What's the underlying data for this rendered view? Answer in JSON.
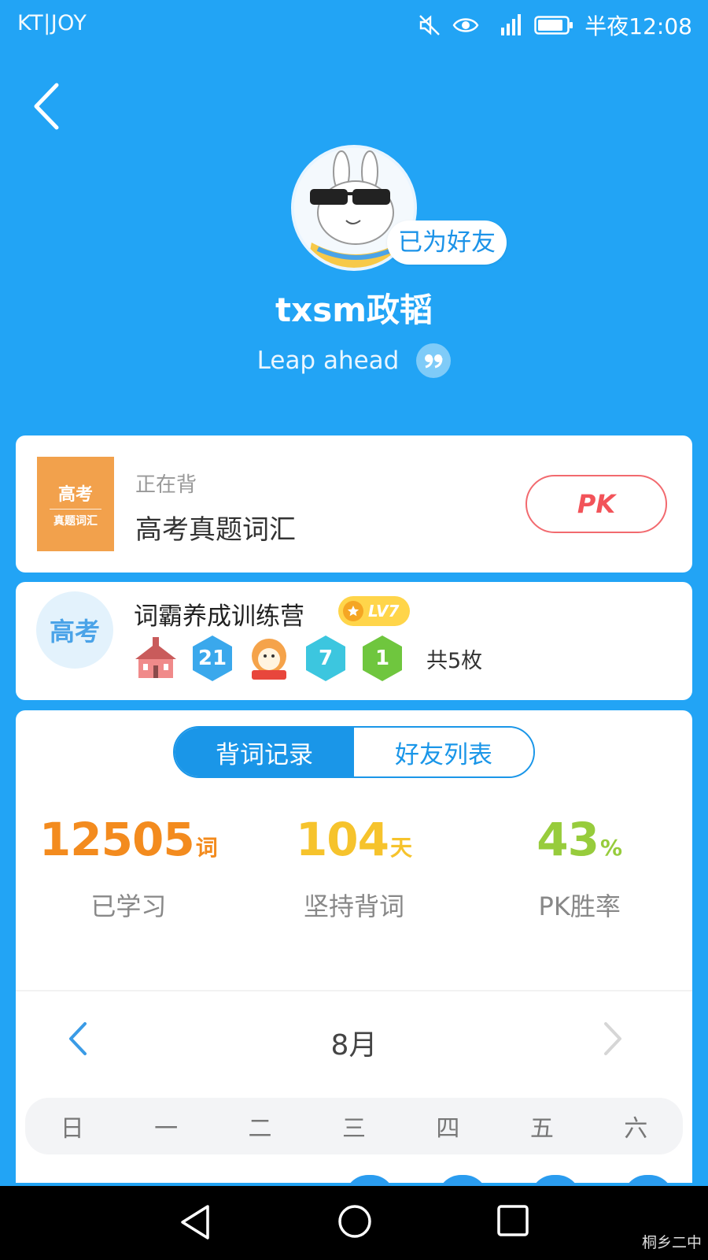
{
  "status_bar": {
    "carrier": "KT|JOY",
    "network": "H R",
    "time": "半夜12:08"
  },
  "profile": {
    "friend_badge": "已为好友",
    "username": "txsm政韬",
    "motto": "Leap ahead"
  },
  "current_book": {
    "label": "正在背",
    "title": "高考真题词汇",
    "cover_line1": "高考",
    "cover_line2": "真题词汇",
    "pk_label": "PK"
  },
  "camp": {
    "logo_text": "高考",
    "title": "词霸养成训练营",
    "level": "LV7",
    "medals": [
      {
        "icon": "school-building-icon",
        "value": ""
      },
      {
        "icon": "hexagon-medal-blue-icon",
        "value": "21",
        "color": "#3aa8ec"
      },
      {
        "icon": "shiba-dog-medal-icon",
        "value": ""
      },
      {
        "icon": "hexagon-medal-cyan-icon",
        "value": "7",
        "color": "#3cc6df"
      },
      {
        "icon": "hexagon-medal-green-icon",
        "value": "1",
        "color": "#6fc63e"
      }
    ],
    "total": "共5枚"
  },
  "tabs": {
    "active": "背词记录",
    "inactive": "好友列表"
  },
  "stats": [
    {
      "value": "12505",
      "unit": "词",
      "label": "已学习",
      "color": "#f38b1e"
    },
    {
      "value": "104",
      "unit": "天",
      "label": "坚持背词",
      "color": "#f6c32c"
    },
    {
      "value": "43",
      "unit": "%",
      "label": "PK胜率",
      "color": "#97cc3c"
    }
  ],
  "calendar": {
    "month": "8月",
    "weekdays": [
      "日",
      "一",
      "二",
      "三",
      "四",
      "五",
      "六"
    ]
  },
  "watermark": "桐乡二中",
  "colors": {
    "primary": "#22a4f5",
    "accent_blue": "#1a96e8",
    "pk_red": "#f25359"
  }
}
